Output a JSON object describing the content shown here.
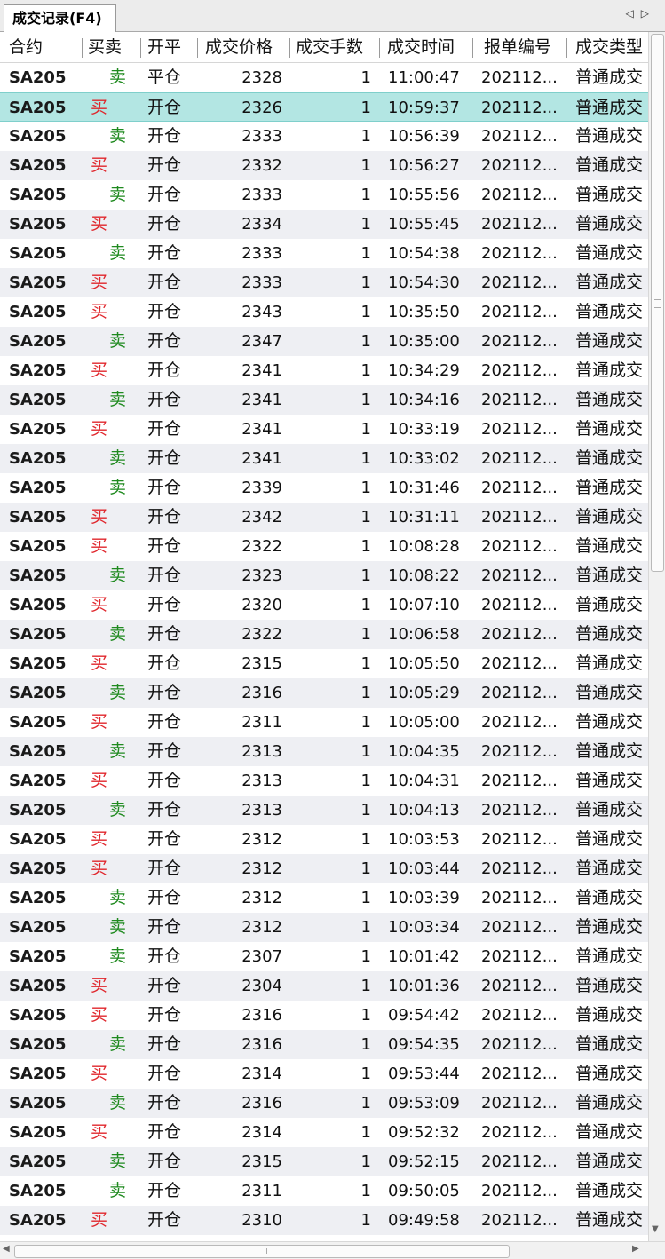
{
  "tab": {
    "title": "成交记录(F4)",
    "prev": "◁",
    "next": "▷"
  },
  "columns": [
    "合约",
    "买卖",
    "开平",
    "成交价格",
    "成交手数",
    "成交时间",
    "报单编号",
    "成交类型"
  ],
  "rows": [
    {
      "inst": "SA205",
      "dir": "卖",
      "oc": "平仓",
      "price": "2328",
      "qty": "1",
      "time": "11:00:47",
      "order": "202112...",
      "type": "普通成交"
    },
    {
      "inst": "SA205",
      "dir": "买",
      "oc": "开仓",
      "price": "2326",
      "qty": "1",
      "time": "10:59:37",
      "order": "202112...",
      "type": "普通成交"
    },
    {
      "inst": "SA205",
      "dir": "卖",
      "oc": "开仓",
      "price": "2333",
      "qty": "1",
      "time": "10:56:39",
      "order": "202112...",
      "type": "普通成交"
    },
    {
      "inst": "SA205",
      "dir": "买",
      "oc": "开仓",
      "price": "2332",
      "qty": "1",
      "time": "10:56:27",
      "order": "202112...",
      "type": "普通成交"
    },
    {
      "inst": "SA205",
      "dir": "卖",
      "oc": "开仓",
      "price": "2333",
      "qty": "1",
      "time": "10:55:56",
      "order": "202112...",
      "type": "普通成交"
    },
    {
      "inst": "SA205",
      "dir": "买",
      "oc": "开仓",
      "price": "2334",
      "qty": "1",
      "time": "10:55:45",
      "order": "202112...",
      "type": "普通成交"
    },
    {
      "inst": "SA205",
      "dir": "卖",
      "oc": "开仓",
      "price": "2333",
      "qty": "1",
      "time": "10:54:38",
      "order": "202112...",
      "type": "普通成交"
    },
    {
      "inst": "SA205",
      "dir": "买",
      "oc": "开仓",
      "price": "2333",
      "qty": "1",
      "time": "10:54:30",
      "order": "202112...",
      "type": "普通成交"
    },
    {
      "inst": "SA205",
      "dir": "买",
      "oc": "开仓",
      "price": "2343",
      "qty": "1",
      "time": "10:35:50",
      "order": "202112...",
      "type": "普通成交"
    },
    {
      "inst": "SA205",
      "dir": "卖",
      "oc": "开仓",
      "price": "2347",
      "qty": "1",
      "time": "10:35:00",
      "order": "202112...",
      "type": "普通成交"
    },
    {
      "inst": "SA205",
      "dir": "买",
      "oc": "开仓",
      "price": "2341",
      "qty": "1",
      "time": "10:34:29",
      "order": "202112...",
      "type": "普通成交"
    },
    {
      "inst": "SA205",
      "dir": "卖",
      "oc": "开仓",
      "price": "2341",
      "qty": "1",
      "time": "10:34:16",
      "order": "202112...",
      "type": "普通成交"
    },
    {
      "inst": "SA205",
      "dir": "买",
      "oc": "开仓",
      "price": "2341",
      "qty": "1",
      "time": "10:33:19",
      "order": "202112...",
      "type": "普通成交"
    },
    {
      "inst": "SA205",
      "dir": "卖",
      "oc": "开仓",
      "price": "2341",
      "qty": "1",
      "time": "10:33:02",
      "order": "202112...",
      "type": "普通成交"
    },
    {
      "inst": "SA205",
      "dir": "卖",
      "oc": "开仓",
      "price": "2339",
      "qty": "1",
      "time": "10:31:46",
      "order": "202112...",
      "type": "普通成交"
    },
    {
      "inst": "SA205",
      "dir": "买",
      "oc": "开仓",
      "price": "2342",
      "qty": "1",
      "time": "10:31:11",
      "order": "202112...",
      "type": "普通成交"
    },
    {
      "inst": "SA205",
      "dir": "买",
      "oc": "开仓",
      "price": "2322",
      "qty": "1",
      "time": "10:08:28",
      "order": "202112...",
      "type": "普通成交"
    },
    {
      "inst": "SA205",
      "dir": "卖",
      "oc": "开仓",
      "price": "2323",
      "qty": "1",
      "time": "10:08:22",
      "order": "202112...",
      "type": "普通成交"
    },
    {
      "inst": "SA205",
      "dir": "买",
      "oc": "开仓",
      "price": "2320",
      "qty": "1",
      "time": "10:07:10",
      "order": "202112...",
      "type": "普通成交"
    },
    {
      "inst": "SA205",
      "dir": "卖",
      "oc": "开仓",
      "price": "2322",
      "qty": "1",
      "time": "10:06:58",
      "order": "202112...",
      "type": "普通成交"
    },
    {
      "inst": "SA205",
      "dir": "买",
      "oc": "开仓",
      "price": "2315",
      "qty": "1",
      "time": "10:05:50",
      "order": "202112...",
      "type": "普通成交"
    },
    {
      "inst": "SA205",
      "dir": "卖",
      "oc": "开仓",
      "price": "2316",
      "qty": "1",
      "time": "10:05:29",
      "order": "202112...",
      "type": "普通成交"
    },
    {
      "inst": "SA205",
      "dir": "买",
      "oc": "开仓",
      "price": "2311",
      "qty": "1",
      "time": "10:05:00",
      "order": "202112...",
      "type": "普通成交"
    },
    {
      "inst": "SA205",
      "dir": "卖",
      "oc": "开仓",
      "price": "2313",
      "qty": "1",
      "time": "10:04:35",
      "order": "202112...",
      "type": "普通成交"
    },
    {
      "inst": "SA205",
      "dir": "买",
      "oc": "开仓",
      "price": "2313",
      "qty": "1",
      "time": "10:04:31",
      "order": "202112...",
      "type": "普通成交"
    },
    {
      "inst": "SA205",
      "dir": "卖",
      "oc": "开仓",
      "price": "2313",
      "qty": "1",
      "time": "10:04:13",
      "order": "202112...",
      "type": "普通成交"
    },
    {
      "inst": "SA205",
      "dir": "买",
      "oc": "开仓",
      "price": "2312",
      "qty": "1",
      "time": "10:03:53",
      "order": "202112...",
      "type": "普通成交"
    },
    {
      "inst": "SA205",
      "dir": "买",
      "oc": "开仓",
      "price": "2312",
      "qty": "1",
      "time": "10:03:44",
      "order": "202112...",
      "type": "普通成交"
    },
    {
      "inst": "SA205",
      "dir": "卖",
      "oc": "开仓",
      "price": "2312",
      "qty": "1",
      "time": "10:03:39",
      "order": "202112...",
      "type": "普通成交"
    },
    {
      "inst": "SA205",
      "dir": "卖",
      "oc": "开仓",
      "price": "2312",
      "qty": "1",
      "time": "10:03:34",
      "order": "202112...",
      "type": "普通成交"
    },
    {
      "inst": "SA205",
      "dir": "卖",
      "oc": "开仓",
      "price": "2307",
      "qty": "1",
      "time": "10:01:42",
      "order": "202112...",
      "type": "普通成交"
    },
    {
      "inst": "SA205",
      "dir": "买",
      "oc": "开仓",
      "price": "2304",
      "qty": "1",
      "time": "10:01:36",
      "order": "202112...",
      "type": "普通成交"
    },
    {
      "inst": "SA205",
      "dir": "买",
      "oc": "开仓",
      "price": "2316",
      "qty": "1",
      "time": "09:54:42",
      "order": "202112...",
      "type": "普通成交"
    },
    {
      "inst": "SA205",
      "dir": "卖",
      "oc": "开仓",
      "price": "2316",
      "qty": "1",
      "time": "09:54:35",
      "order": "202112...",
      "type": "普通成交"
    },
    {
      "inst": "SA205",
      "dir": "买",
      "oc": "开仓",
      "price": "2314",
      "qty": "1",
      "time": "09:53:44",
      "order": "202112...",
      "type": "普通成交"
    },
    {
      "inst": "SA205",
      "dir": "卖",
      "oc": "开仓",
      "price": "2316",
      "qty": "1",
      "time": "09:53:09",
      "order": "202112...",
      "type": "普通成交"
    },
    {
      "inst": "SA205",
      "dir": "买",
      "oc": "开仓",
      "price": "2314",
      "qty": "1",
      "time": "09:52:32",
      "order": "202112...",
      "type": "普通成交"
    },
    {
      "inst": "SA205",
      "dir": "卖",
      "oc": "开仓",
      "price": "2315",
      "qty": "1",
      "time": "09:52:15",
      "order": "202112...",
      "type": "普通成交"
    },
    {
      "inst": "SA205",
      "dir": "卖",
      "oc": "开仓",
      "price": "2311",
      "qty": "1",
      "time": "09:50:05",
      "order": "202112...",
      "type": "普通成交"
    },
    {
      "inst": "SA205",
      "dir": "买",
      "oc": "开仓",
      "price": "2310",
      "qty": "1",
      "time": "09:49:58",
      "order": "202112...",
      "type": "普通成交"
    }
  ],
  "selected_row": 1,
  "colors": {
    "buy": "#e0252b",
    "sell": "#1f8a1f",
    "selected_bg": "#b3e6e3",
    "alt_bg": "#eeeff3"
  }
}
